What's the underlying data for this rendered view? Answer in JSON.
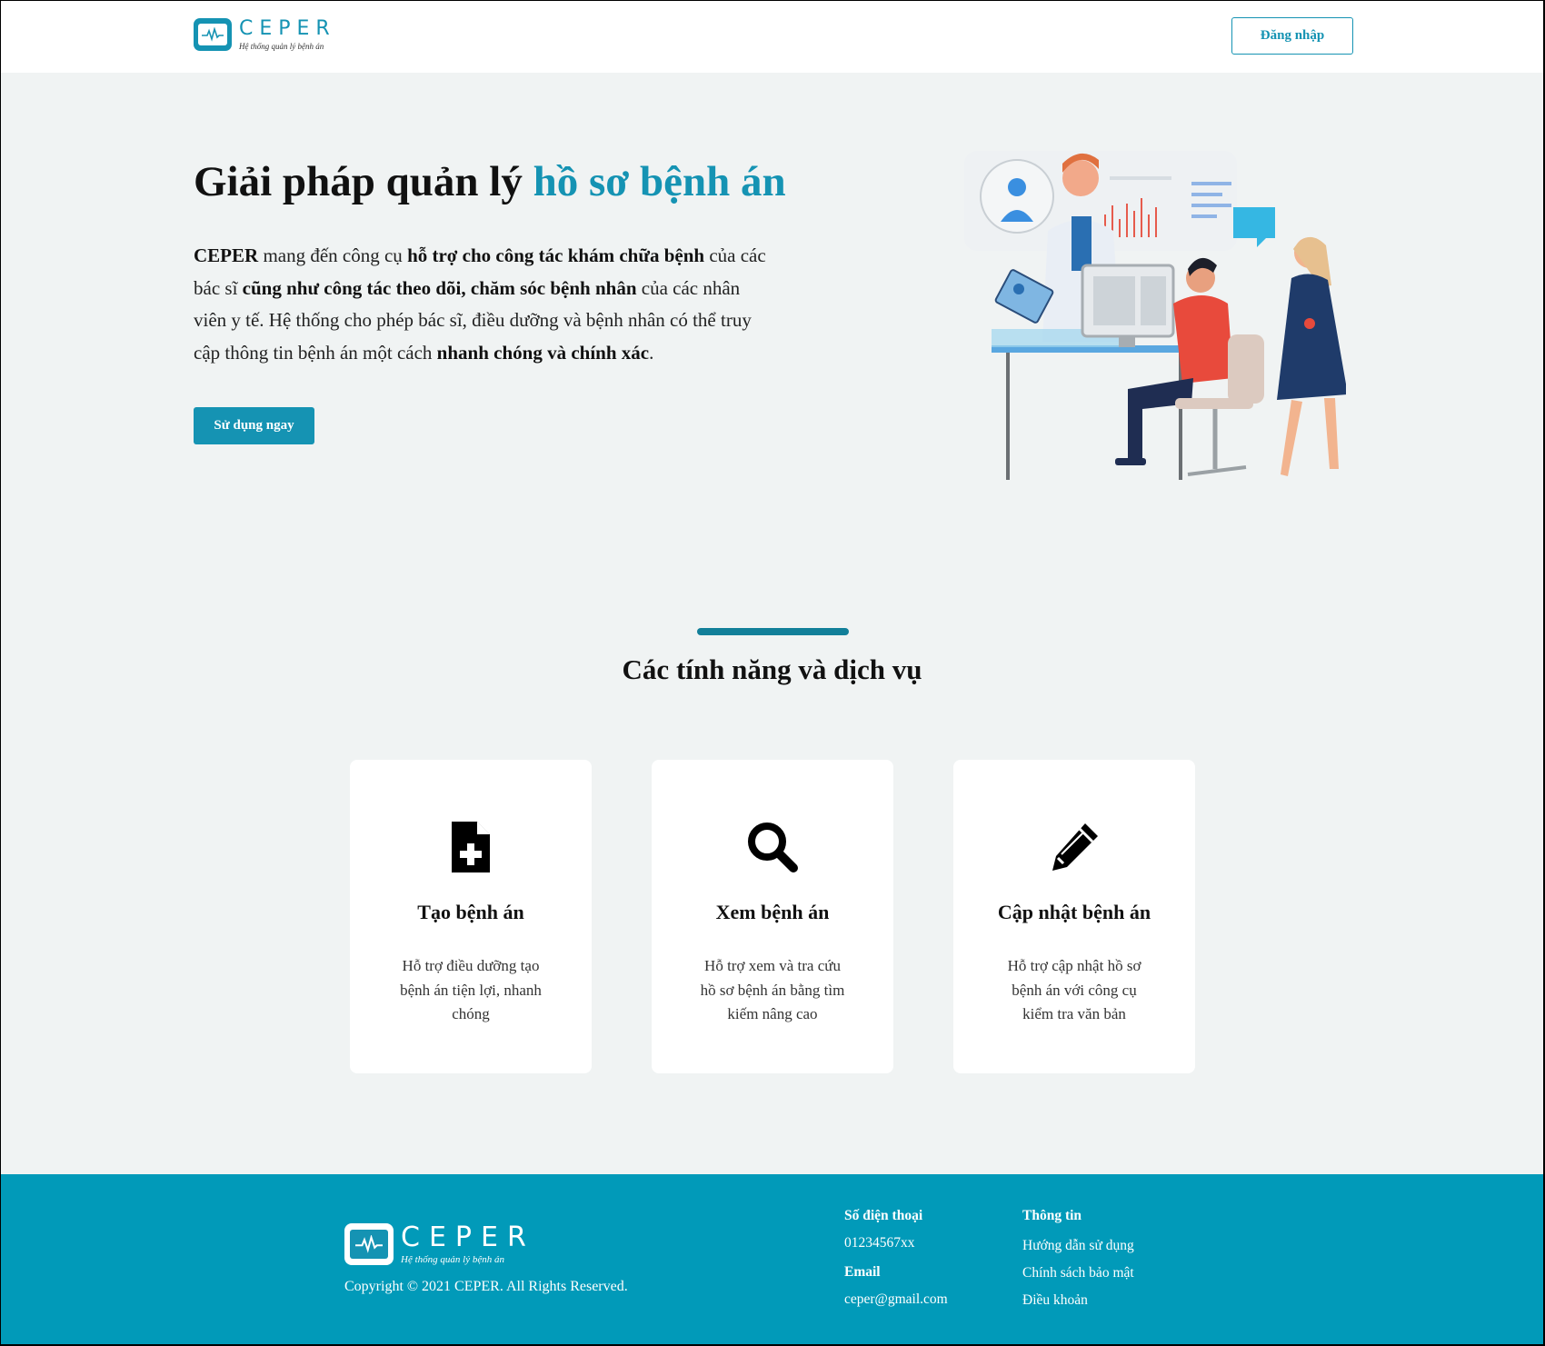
{
  "header": {
    "logo_name": "CEPER",
    "logo_tagline": "Hệ thống quản lý bệnh án",
    "login_label": "Đăng nhập"
  },
  "hero": {
    "title_main": "Giải pháp quản lý ",
    "title_highlight": "hồ sơ bệnh án",
    "desc": [
      {
        "t": "CEPER",
        "b": true
      },
      {
        "t": " mang đến công cụ ",
        "b": false
      },
      {
        "t": "hỗ trợ cho công tác khám chữa bệnh",
        "b": true
      },
      {
        "t": " của các bác sĩ ",
        "b": false
      },
      {
        "t": "cũng như công tác theo dõi, chăm sóc bệnh nhân",
        "b": true
      },
      {
        "t": " của các nhân viên y tế. Hệ thống cho phép bác sĩ, điều dưỡng và bệnh nhân có thể truy cập thông tin bệnh án một cách ",
        "b": false
      },
      {
        "t": "nhanh chóng và chính xác",
        "b": true
      },
      {
        "t": ".",
        "b": false
      }
    ],
    "cta_label": "Sử dụng ngay"
  },
  "features": {
    "title": "Các tính năng và dịch vụ",
    "cards": [
      {
        "icon": "file-medical-icon",
        "title": "Tạo bệnh án",
        "desc": "Hỗ trợ điều dưỡng tạo bệnh án tiện lợi, nhanh chóng"
      },
      {
        "icon": "search-icon",
        "title": "Xem bệnh án",
        "desc": "Hỗ trợ xem và tra cứu hồ sơ bệnh án bằng tìm kiếm nâng cao"
      },
      {
        "icon": "pencil-icon",
        "title": "Cập nhật bệnh án",
        "desc": "Hỗ trợ cập nhật hồ sơ bệnh án với công cụ kiểm tra văn bản"
      }
    ]
  },
  "footer": {
    "logo_name": "CEPER",
    "logo_tagline": "Hệ thống quản lý bệnh án",
    "copyright": "Copyright © 2021 CEPER. All Rights Reserved.",
    "phone_label": "Số điện thoại",
    "phone": "01234567xx",
    "email_label": "Email",
    "email": "ceper@gmail.com",
    "info_label": "Thông tin",
    "links": [
      "Hướng dẫn sử dụng",
      "Chính sách bảo mật",
      "Điều khoản"
    ]
  },
  "colors": {
    "primary": "#1593b3",
    "footer_bg": "#019ab9",
    "page_bg": "#f0f3f3"
  }
}
